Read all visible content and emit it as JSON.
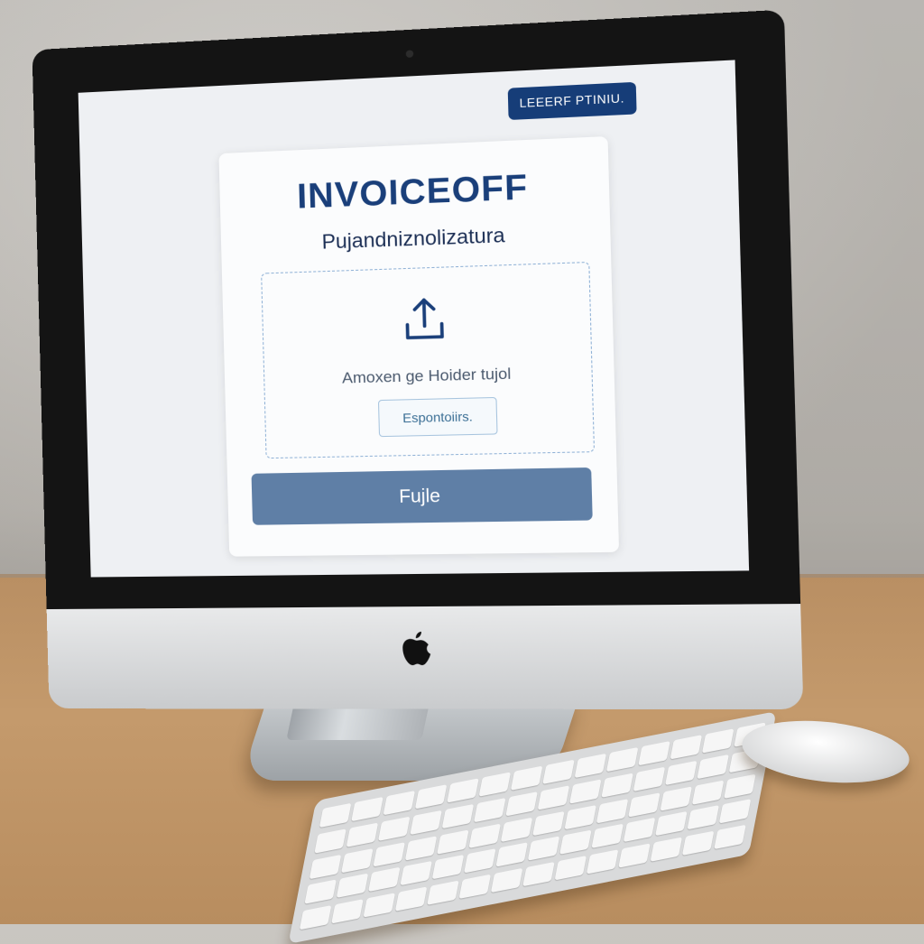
{
  "header": {
    "top_button_label": "LEEERF PTINIU."
  },
  "card": {
    "title": "INVOICEOFF",
    "subtitle": "Pujandniznolizatura",
    "dropzone": {
      "icon": "upload-icon",
      "text": "Amoxen ge Hoider tujol",
      "browse_label": "Espontoiirs."
    },
    "submit_label": "Fujle"
  },
  "colors": {
    "accent": "#163d78",
    "title": "#1a3f7a",
    "submit_button": "#5f7fa6",
    "dropzone_border": "#8fb1d6"
  }
}
